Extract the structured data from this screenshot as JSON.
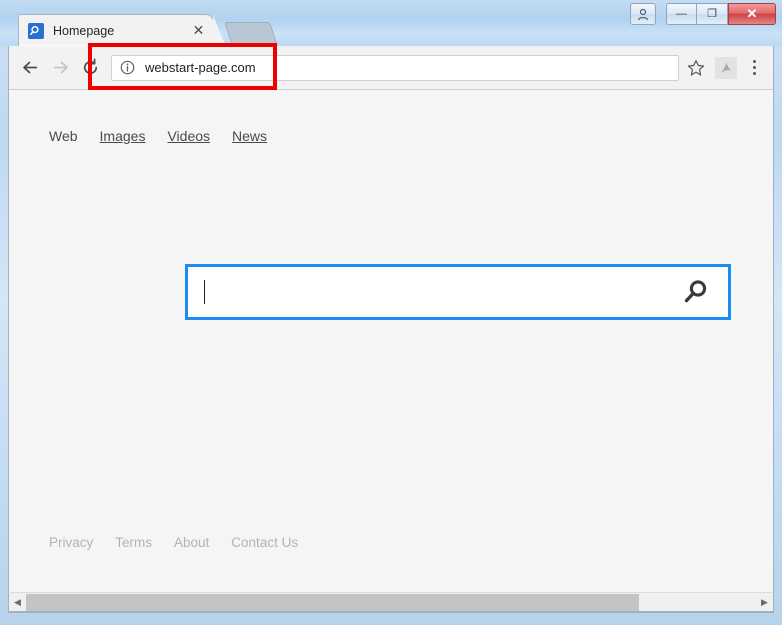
{
  "window": {
    "controls": {
      "user_icon": "user-account-icon",
      "minimize_label": "—",
      "restore_label": "❐",
      "close_label": "✕"
    }
  },
  "tab": {
    "title": "Homepage",
    "favicon": "search-magnifier-favicon",
    "close_label": "✕",
    "new_tab_label": ""
  },
  "toolbar": {
    "back_label": "←",
    "forward_label": "→",
    "reload_label": "↻",
    "url": "webstart-page.com",
    "site_info_icon": "info-circle-icon",
    "bookmark_icon": "star-icon",
    "extension_icon": "pdf-extension-icon",
    "menu_icon": "three-dot-menu-icon"
  },
  "page": {
    "nav": [
      {
        "label": "Web",
        "active": true
      },
      {
        "label": "Images",
        "active": false
      },
      {
        "label": "Videos",
        "active": false
      },
      {
        "label": "News",
        "active": false
      }
    ],
    "search": {
      "value": "",
      "placeholder": "",
      "submit_icon": "search-magnifier-icon"
    },
    "footer": [
      {
        "label": "Privacy"
      },
      {
        "label": "Terms"
      },
      {
        "label": "About"
      },
      {
        "label": "Contact Us"
      }
    ]
  },
  "scrollbar": {
    "left_arrow": "◀",
    "right_arrow": "▶",
    "thumb_percent": 84
  },
  "annotation": {
    "color": "#ee0000",
    "target": "address-bar"
  },
  "colors": {
    "accent_blue": "#1a8cf0",
    "favicon_blue": "#2a6fd0",
    "page_background": "#f5f5f5",
    "chrome_background": "#f2f2f2",
    "annotation_red": "#ee0000"
  }
}
